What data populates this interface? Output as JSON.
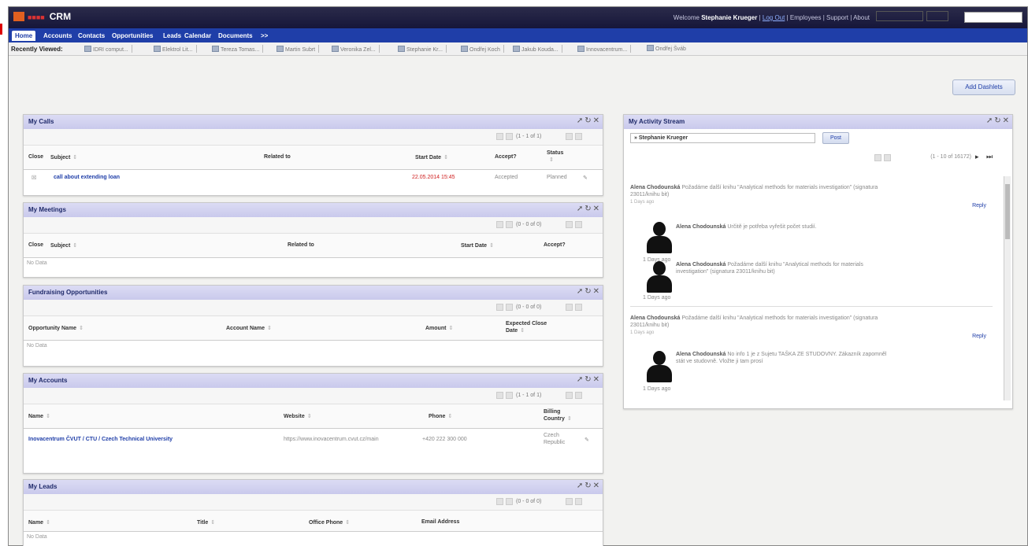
{
  "header": {
    "app_name": "CRM",
    "welcome_prefix": "Welcome",
    "user_name": "Stephanie Krueger",
    "logout": "Log Out",
    "links": "Employees | Support | About"
  },
  "nav": {
    "tabs": [
      "Home",
      "Accounts",
      "Contacts",
      "Opportunities",
      "Leads",
      "Calendar",
      "Documents",
      ">>"
    ]
  },
  "recent": {
    "label": "Recently Viewed:",
    "items": [
      "IDRI comput...",
      "Elektrol Lit...",
      "Tereza Tomas...",
      "Martin Subrt",
      "Veronika Zel...",
      "Stephanie Kr...",
      "Ondřej Koch",
      "Jakub Kouda...",
      "Innovacentrum...",
      "Ondřej Šváb"
    ]
  },
  "dashboard": {
    "add_dashlets": "Add Dashlets"
  },
  "calls": {
    "title": "My Calls",
    "pager": "(1 - 1 of 1)",
    "headers": [
      "Close",
      "Subject",
      "Related to",
      "Start Date",
      "Accept?",
      "Status"
    ],
    "row": {
      "subject": "call about extending loan",
      "start": "22.05.2014 15:45",
      "accept": "Accepted",
      "status": "Planned"
    }
  },
  "meetings": {
    "title": "My Meetings",
    "pager": "(0 - 0 of 0)",
    "headers": [
      "Close",
      "Subject",
      "Related to",
      "Start Date",
      "Accept?"
    ],
    "nodata": "No Data"
  },
  "fundraising": {
    "title": "Fundraising Opportunities",
    "pager": "(0 - 0 of 0)",
    "headers": [
      "Opportunity Name",
      "Account Name",
      "Amount",
      "Expected Close",
      "Date"
    ],
    "nodata": "No Data"
  },
  "accounts": {
    "title": "My Accounts",
    "pager": "(1 - 1 of 1)",
    "headers": [
      "Name",
      "Website",
      "Phone",
      "Billing",
      "Country"
    ],
    "row": {
      "name": "Inovacentrum ČVUT / CTU / Czech Technical University",
      "website": "https://www.inovacentrum.cvut.cz/main",
      "phone": "+420 222 300 000",
      "country1": "Czech",
      "country2": "Republic"
    }
  },
  "leads": {
    "title": "My Leads",
    "pager": "(0 - 0 of 0)",
    "headers": [
      "Name",
      "Title",
      "Office Phone",
      "Email Address"
    ],
    "nodata": "No Data"
  },
  "activity": {
    "title": "My Activity Stream",
    "input_value": "» Stephanie Krueger",
    "post": "Post",
    "pager": "(1 - 10 of 16172)",
    "reply": "Reply",
    "posts": [
      {
        "author": "Alena Chodounská",
        "text": "Požadáme další knihu \"Analytical methods for materials investigation\" (signatura",
        "text2": "23011/knihu bit)",
        "ago": "1 Days ago"
      },
      {
        "author": "Alena Chodounská",
        "text": "Určitě je potřeba vyřešit počet studií.",
        "ago": "1 Days ago"
      },
      {
        "author": "Alena Chodounská",
        "text": "Požadáme další knihu \"Analytical methods for materials",
        "text2": "investigation\" (signatura 23011/knihu bit)",
        "ago": "1 Days ago"
      },
      {
        "author": "Alena Chodounská",
        "text": "Požadáme další knihu \"Analytical methods for materials investigation\" (signatura",
        "text2": "23011/knihu bit)",
        "ago": "1 Days ago"
      },
      {
        "author": "Alena Chodounská",
        "text": "No info 1 je z Sujetu TAŠKA ZE STUDOVNY. Zákazník zapomněl",
        "text2": "stát ve studovně. Vložte ji tam prosí",
        "ago": "1 Days ago"
      }
    ]
  }
}
